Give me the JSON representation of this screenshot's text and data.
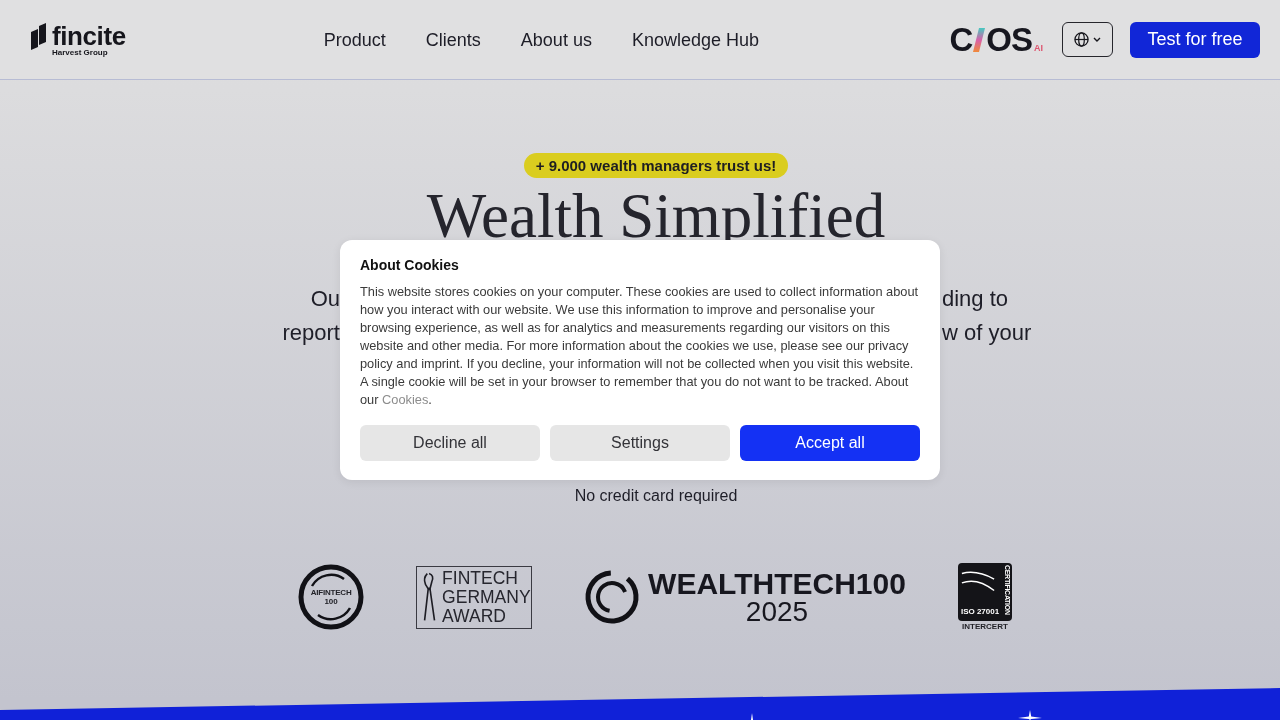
{
  "header": {
    "logo": {
      "name": "fincite",
      "tagline": "Harvest Group"
    },
    "nav": [
      "Product",
      "Clients",
      "About us",
      "Knowledge Hub"
    ],
    "brand_mark": {
      "left": "C",
      "right": "OS",
      "suffix": "AI"
    },
    "cta": "Test for free"
  },
  "hero": {
    "badge": "+ 9.000 wealth managers trust us!",
    "title": "Wealth Simplified",
    "intro_fragments": [
      {
        "left": "Ou",
        "right": "ding to"
      },
      {
        "left": "report",
        "right": "w of your"
      }
    ],
    "note": "No credit card required"
  },
  "awards": [
    {
      "kind": "ring",
      "lines": [
        "AIFINTECH",
        "100"
      ]
    },
    {
      "kind": "framed",
      "lines": [
        "FINTECH",
        "GERMANY",
        "AWARD"
      ]
    },
    {
      "kind": "wordmark",
      "lines": [
        "WEALTHTECH100",
        "2025"
      ]
    },
    {
      "kind": "certificate",
      "lines": [
        "ISO 27001",
        "CERTIFICATION",
        "INTERCERT"
      ]
    }
  ],
  "cookie_dialog": {
    "title": "About Cookies",
    "text": "This website stores cookies on your computer. These cookies are used to collect information about how you interact with our website. We use this information to improve and personalise your browsing experience, as well as for analytics and measurements regarding our visitors on this website and other media. For more information about the cookies we use, please see our privacy policy and imprint. If you decline, your information will not be collected when you visit this website. A single cookie will be set in your browser to remember that you do not want to be tracked. About our",
    "link": "Cookies",
    "text_after": ".",
    "buttons": [
      {
        "label": "Decline all",
        "kind": "secondary"
      },
      {
        "label": "Settings",
        "kind": "secondary"
      },
      {
        "label": "Accept all",
        "kind": "primary"
      }
    ]
  }
}
